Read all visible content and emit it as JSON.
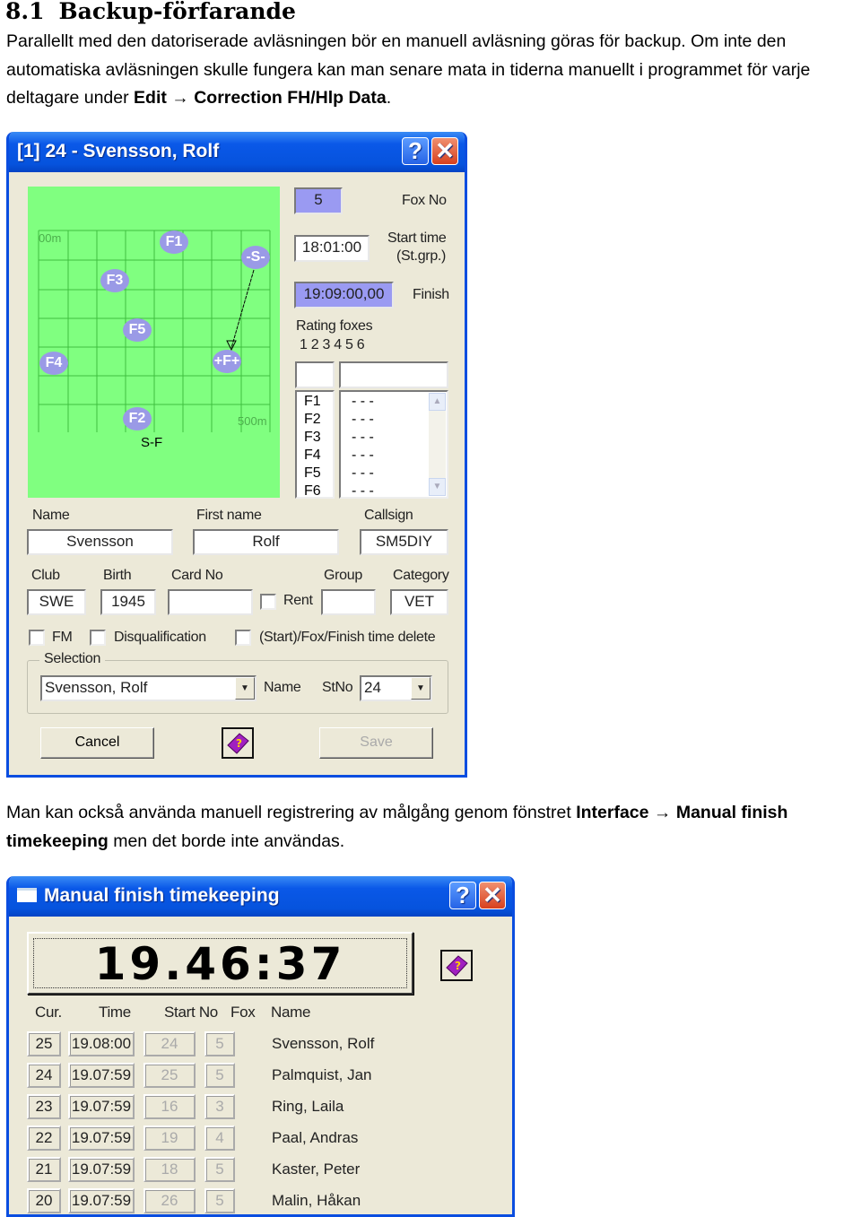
{
  "heading": {
    "number": "8.1",
    "title": "Backup-förfarande"
  },
  "para1": {
    "text": "Parallellt med den datoriserade avläsningen bör en manuell avläsning göras för backup. Om inte den automatiska avläsningen skulle fungera kan man senare mata in tiderna manuellt i programmet för varje deltagare under ",
    "bold1": "Edit",
    "arrow": "→",
    "bold2": "Correction FH/Hlp Data",
    "end": "."
  },
  "dialog1": {
    "title": "[1] 24 - Svensson, Rolf",
    "help": "?",
    "close": "✕",
    "map": {
      "scale_top": "00m",
      "scale_bottom": "500m",
      "sf_label": "S-F",
      "foxes": [
        "F1",
        "-S-",
        "F3",
        "F5",
        "F4",
        "+F+",
        "F2"
      ]
    },
    "fox_no": {
      "value": "5",
      "label": "Fox No"
    },
    "start_time": {
      "value": "18:01:00",
      "label1": "Start time",
      "label2": "(St.grp.)"
    },
    "finish": {
      "value": "19:09:00,00",
      "label": "Finish"
    },
    "rating": {
      "label": "Rating foxes",
      "numbers": "1 2 3 4 5 6"
    },
    "fox_list": [
      "F1",
      "F2",
      "F3",
      "F4",
      "F5",
      "F6"
    ],
    "fox_times": [
      "- - -",
      "- - -",
      "- - -",
      "- - -",
      "- - -",
      "- - -"
    ],
    "name": {
      "label": "Name",
      "value": "Svensson"
    },
    "first_name": {
      "label": "First name",
      "value": "Rolf"
    },
    "callsign": {
      "label": "Callsign",
      "value": "SM5DIY"
    },
    "club": {
      "label": "Club",
      "value": "SWE"
    },
    "birth": {
      "label": "Birth",
      "value": "1945"
    },
    "card_no": {
      "label": "Card No",
      "value": ""
    },
    "rent": {
      "label": "Rent",
      "checked": false
    },
    "group": {
      "label": "Group",
      "value": ""
    },
    "category": {
      "label": "Category",
      "value": "VET"
    },
    "fm": {
      "label": "FM",
      "checked": false
    },
    "disq": {
      "label": "Disqualification",
      "checked": false
    },
    "delete": {
      "label": "(Start)/Fox/Finish time delete",
      "checked": false
    },
    "selection": {
      "legend": "Selection",
      "name_value": "Svensson, Rolf",
      "name_label": "Name",
      "stno_label": "StNo",
      "stno_value": "24"
    },
    "cancel": "Cancel",
    "save": "Save"
  },
  "para2": {
    "text": "Man kan också använda manuell registrering av målgång genom fönstret ",
    "bold1": "Interface",
    "arrow": "→",
    "bold2": "Manual finish timekeeping",
    "end": " men det borde inte användas."
  },
  "dialog2": {
    "title": "Manual finish timekeeping",
    "help": "?",
    "close": "✕",
    "clock": "19.46:37",
    "headers": [
      "Cur.",
      "Time",
      "Start No",
      "Fox",
      "Name"
    ],
    "rows": [
      {
        "cur": "25",
        "time": "19.08:00",
        "start": "24",
        "fox": "5",
        "name": "Svensson, Rolf"
      },
      {
        "cur": "24",
        "time": "19.07:59",
        "start": "25",
        "fox": "5",
        "name": "Palmquist, Jan"
      },
      {
        "cur": "23",
        "time": "19.07:59",
        "start": "16",
        "fox": "3",
        "name": "Ring, Laila"
      },
      {
        "cur": "22",
        "time": "19.07:59",
        "start": "19",
        "fox": "4",
        "name": "Paal, Andras"
      },
      {
        "cur": "21",
        "time": "19.07:59",
        "start": "18",
        "fox": "5",
        "name": "Kaster, Peter"
      },
      {
        "cur": "20",
        "time": "19.07:59",
        "start": "26",
        "fox": "5",
        "name": "Malin, Håkan"
      }
    ]
  }
}
